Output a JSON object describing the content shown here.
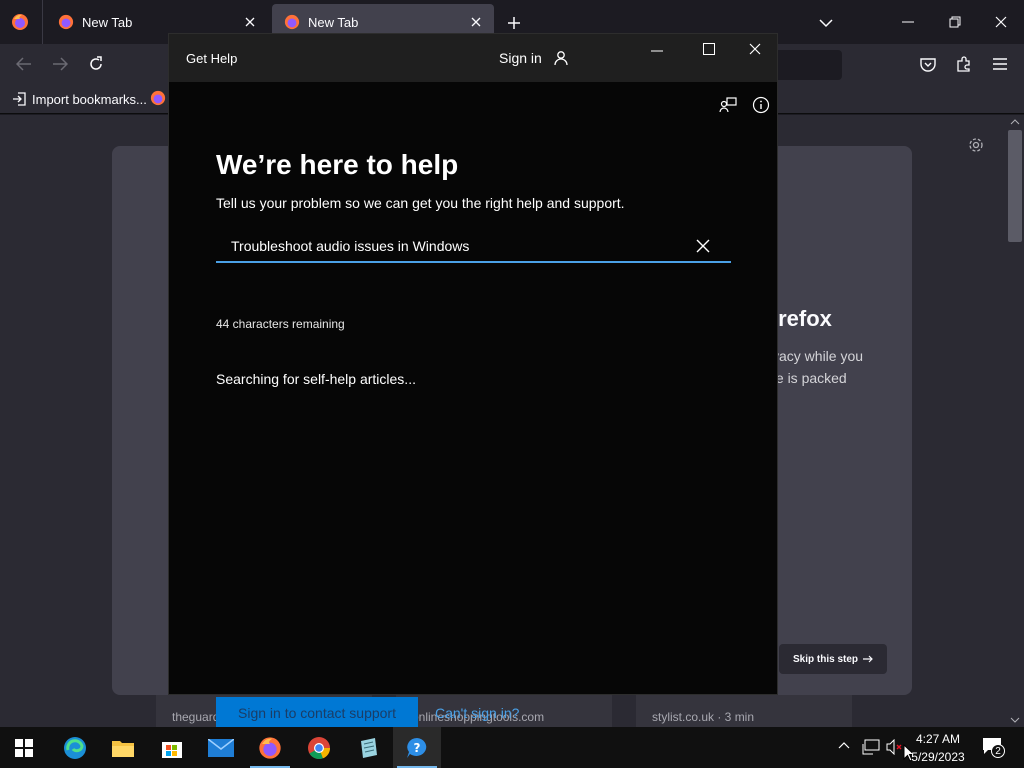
{
  "browser": {
    "tabs": [
      {
        "label": "New Tab"
      },
      {
        "label": "New Tab"
      }
    ],
    "bookmarks_import": "Import bookmarks...",
    "newtab": {
      "headline_partial": "irefox",
      "body_line1": "vacy while you",
      "body_line2": "te is packed",
      "skip_label": "Skip this step",
      "shortcuts": [
        {
          "label": "theguardian.com · 5 min"
        },
        {
          "label": "onlineshoppingtools.com"
        },
        {
          "label": "stylist.co.uk · 3 min"
        }
      ]
    }
  },
  "gethelp": {
    "window_title": "Get Help",
    "sign_in": "Sign in",
    "heading": "We’re here to help",
    "subtitle": "Tell us your problem so we can get you the right help and support.",
    "search_value": "Troubleshoot audio issues in Windows",
    "chars_remaining": "44 characters remaining",
    "status": "Searching for self-help articles...",
    "contact_button": "Sign in to contact support",
    "cant_sign_in": "Can't sign in?"
  },
  "taskbar": {
    "time": "4:27 AM",
    "date": "5/29/2023",
    "notification_count": "2"
  },
  "colors": {
    "accent": "#0078d4",
    "link": "#4aa0e6",
    "firefox_bg": "#2b2a33"
  }
}
